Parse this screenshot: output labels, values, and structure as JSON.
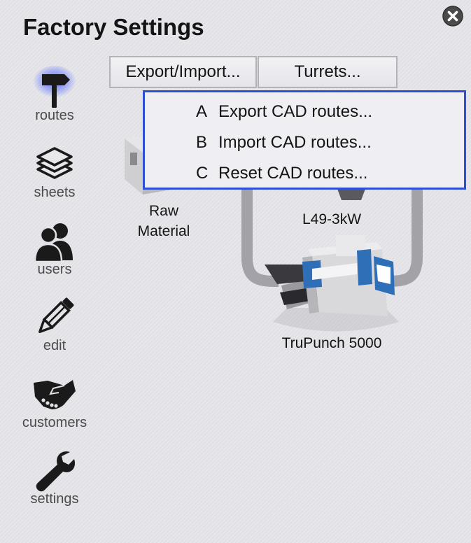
{
  "window": {
    "title": "Factory Settings"
  },
  "sidebar": {
    "items": [
      {
        "id": "routes",
        "label": "routes",
        "icon": "signpost-icon",
        "active": true
      },
      {
        "id": "sheets",
        "label": "sheets",
        "icon": "sheets-stack-icon"
      },
      {
        "id": "users",
        "label": "users",
        "icon": "users-icon"
      },
      {
        "id": "edit",
        "label": "edit",
        "icon": "pencil-icon"
      },
      {
        "id": "customers",
        "label": "customers",
        "icon": "handshake-icon"
      },
      {
        "id": "settings",
        "label": "settings",
        "icon": "wrench-icon"
      }
    ]
  },
  "toolbar": {
    "export_import_label": "Export/Import...",
    "turrets_label": "Turrets..."
  },
  "dropdown": {
    "items": [
      {
        "key": "A",
        "label": "Export CAD routes..."
      },
      {
        "key": "B",
        "label": "Import CAD routes..."
      },
      {
        "key": "C",
        "label": "Reset CAD routes..."
      }
    ]
  },
  "canvas": {
    "nodes": {
      "raw_material": {
        "line1": "Raw",
        "line2": "Material"
      },
      "laser": {
        "label": "L49-3kW"
      },
      "punch": {
        "label": "TruPunch 5000"
      }
    }
  },
  "colors": {
    "accent": "#2f4fd2",
    "active_glow": "#5a6cff",
    "machine_blue": "#2f6fb8"
  }
}
